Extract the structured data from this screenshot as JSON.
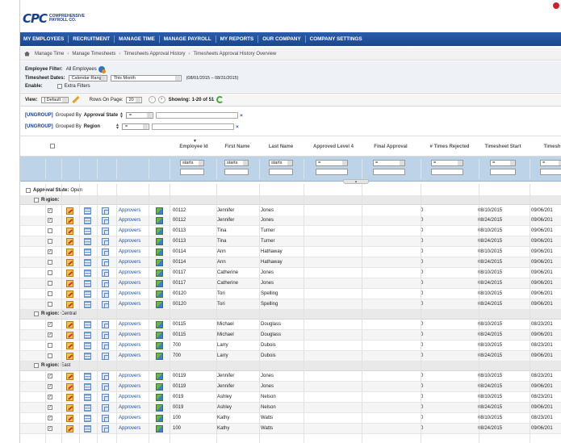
{
  "brand": {
    "logo": "CPC",
    "line1": "COMPREHENSIVE",
    "line2": "PAYROLL CO."
  },
  "nav": [
    "MY EMPLOYEES",
    "RECRUITMENT",
    "MANAGE TIME",
    "MANAGE PAYROLL",
    "MY REPORTS",
    "OUR COMPANY",
    "COMPANY SETTINGS"
  ],
  "breadcrumbs": [
    "Manage Time",
    "Manage Timesheets",
    "Timesheets Approval History",
    "Timesheets Approval History Overview"
  ],
  "filters": {
    "employee_label": "Employee Filter:",
    "employee_value": "All Employees",
    "dates_label": "Timesheet Dates:",
    "dates_type": "Calendar Range",
    "dates_range": "This Month",
    "dates_span": "(08/01/2015 – 08/31/2015)",
    "enable_label": "Enable:",
    "extra_filters": "Extra Filters"
  },
  "viewbar": {
    "view_label": "View:",
    "view_value": "[ Default ]",
    "rows_label": "Rows On Page:",
    "rows_value": "20",
    "showing_label": "Showing:",
    "showing_value": "1-20 of 51"
  },
  "groups": [
    {
      "ungroup": "[UNGROUP]",
      "text": "Grouped By",
      "field": "Approval State",
      "op": "="
    },
    {
      "ungroup": "[UNGROUP]",
      "text": "Grouped By",
      "field": "Region",
      "op": "="
    }
  ],
  "columns": {
    "employee_id": "Employee Id",
    "first_name": "First Name",
    "last_name": "Last Name",
    "approved_level4": "Approved Level 4",
    "final_approval": "Final Approval",
    "times_rejected": "# Times Rejected",
    "timesheet_start": "Timesheet Start",
    "timesheet_end": "Timesh"
  },
  "column_filters": {
    "starts": "starts",
    "eq": "="
  },
  "approval_state": {
    "label": "Approval State:",
    "value": "Open"
  },
  "regions": [
    {
      "label": "Region:",
      "name": "",
      "rows": [
        {
          "checked": true,
          "link": "Approvers",
          "id": "00112",
          "first": "Jennifer",
          "last": "Jones",
          "rejected": "0",
          "start": "08/10/2015",
          "end": "09/06/201"
        },
        {
          "checked": true,
          "link": "Approvers",
          "id": "00112",
          "first": "Jennifer",
          "last": "Jones",
          "rejected": "0",
          "start": "08/24/2015",
          "end": "09/06/201"
        },
        {
          "checked": false,
          "link": "Approvers",
          "id": "00113",
          "first": "Tina",
          "last": "Turner",
          "rejected": "0",
          "start": "08/10/2015",
          "end": "09/06/201"
        },
        {
          "checked": false,
          "link": "Approvers",
          "id": "00113",
          "first": "Tina",
          "last": "Turner",
          "rejected": "0",
          "start": "08/24/2015",
          "end": "09/06/201"
        },
        {
          "checked": true,
          "link": "Approvers",
          "id": "00114",
          "first": "Ann",
          "last": "Hathaway",
          "rejected": "0",
          "start": "08/10/2015",
          "end": "09/06/201"
        },
        {
          "checked": false,
          "link": "Approvers",
          "id": "00114",
          "first": "Ann",
          "last": "Hathaway",
          "rejected": "0",
          "start": "08/24/2015",
          "end": "09/06/201"
        },
        {
          "checked": false,
          "link": "Approvers",
          "id": "00117",
          "first": "Catherine",
          "last": "Jones",
          "rejected": "0",
          "start": "08/10/2015",
          "end": "09/06/201"
        },
        {
          "checked": false,
          "link": "Approvers",
          "id": "00117",
          "first": "Catherine",
          "last": "Jones",
          "rejected": "0",
          "start": "08/24/2015",
          "end": "09/06/201"
        },
        {
          "checked": false,
          "link": "Approvers",
          "id": "00120",
          "first": "Tori",
          "last": "Spelling",
          "rejected": "0",
          "start": "08/10/2015",
          "end": "09/06/201"
        },
        {
          "checked": false,
          "link": "Approvers",
          "id": "00120",
          "first": "Tori",
          "last": "Spelling",
          "rejected": "0",
          "start": "08/24/2015",
          "end": "09/06/201"
        }
      ]
    },
    {
      "label": "Region:",
      "name": "Central",
      "rows": [
        {
          "checked": true,
          "link": "Approvers",
          "id": "00115",
          "first": "Michael",
          "last": "Douglass",
          "rejected": "0",
          "start": "08/10/2015",
          "end": "08/23/201"
        },
        {
          "checked": true,
          "link": "Approvers",
          "id": "00115",
          "first": "Michael",
          "last": "Douglass",
          "rejected": "0",
          "start": "08/24/2015",
          "end": "09/06/201"
        },
        {
          "checked": false,
          "link": "Approvers",
          "id": "700",
          "first": "Larry",
          "last": "Dubois",
          "rejected": "0",
          "start": "08/10/2015",
          "end": "08/23/201"
        },
        {
          "checked": false,
          "link": "Approvers",
          "id": "700",
          "first": "Larry",
          "last": "Dubois",
          "rejected": "0",
          "start": "08/24/2015",
          "end": "09/06/201"
        }
      ]
    },
    {
      "label": "Region:",
      "name": "East",
      "rows": [
        {
          "checked": true,
          "link": "Approvers",
          "id": "00119",
          "first": "Jennifer",
          "last": "Jones",
          "rejected": "0",
          "start": "08/10/2015",
          "end": "08/23/201"
        },
        {
          "checked": true,
          "link": "Approvers",
          "id": "00119",
          "first": "Jennifer",
          "last": "Jones",
          "rejected": "0",
          "start": "08/24/2015",
          "end": "09/06/201"
        },
        {
          "checked": true,
          "link": "Approvers",
          "id": "0019",
          "first": "Ashley",
          "last": "Nelson",
          "rejected": "0",
          "start": "08/10/2015",
          "end": "08/23/201"
        },
        {
          "checked": true,
          "link": "Approvers",
          "id": "0019",
          "first": "Ashley",
          "last": "Nelson",
          "rejected": "0",
          "start": "08/24/2015",
          "end": "09/06/201"
        },
        {
          "checked": true,
          "link": "Approvers",
          "id": "100",
          "first": "Kathy",
          "last": "Watts",
          "rejected": "0",
          "start": "08/10/2015",
          "end": "08/23/201"
        },
        {
          "checked": true,
          "link": "Approvers",
          "id": "100",
          "first": "Kathy",
          "last": "Watts",
          "rejected": "0",
          "start": "08/24/2015",
          "end": "09/06/201"
        }
      ]
    }
  ],
  "colors": {
    "nav": "#1b468c",
    "filterrow": "#bcd3e8",
    "link": "#1c4e9c"
  }
}
